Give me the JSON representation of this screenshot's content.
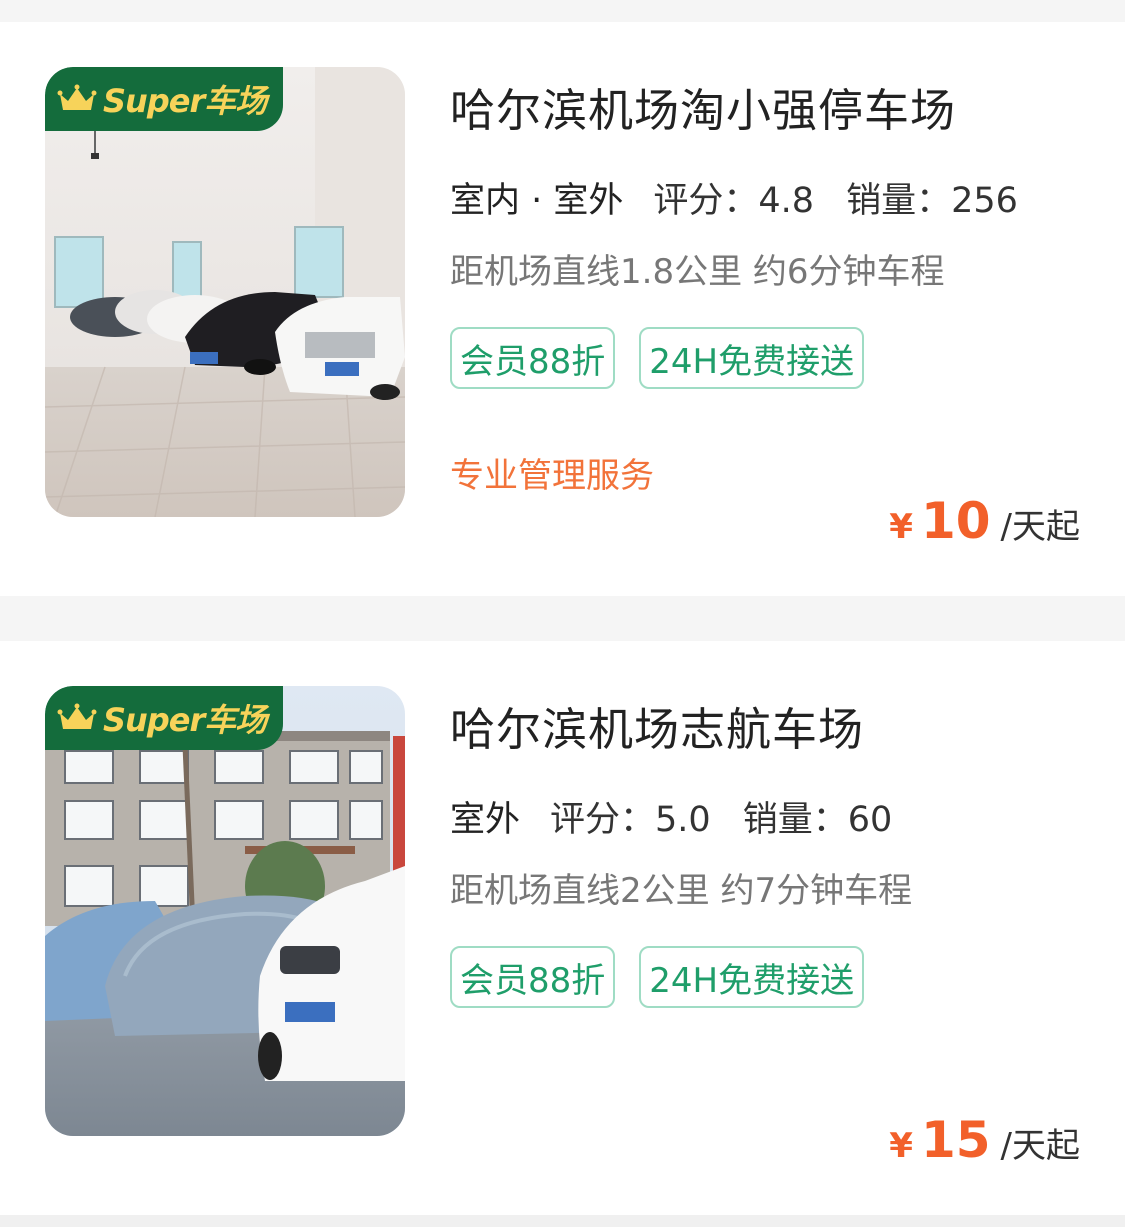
{
  "listings": [
    {
      "badge": "Super车场",
      "title": "哈尔滨机场淘小强停车场",
      "environment": "室内 · 室外",
      "rating_label": "评分：",
      "rating": "4.8",
      "sales_label": "销量：",
      "sales": "256",
      "distance": "距机场直线1.8公里 约6分钟车程",
      "tags": [
        "会员88折",
        "24H免费接送"
      ],
      "note": "专业管理服务",
      "currency": "¥",
      "price": "10",
      "price_unit": "/天起"
    },
    {
      "badge": "Super车场",
      "title": "哈尔滨机场志航车场",
      "environment": "室外",
      "rating_label": "评分：",
      "rating": "5.0",
      "sales_label": "销量：",
      "sales": "60",
      "distance": "距机场直线2公里 约7分钟车程",
      "tags": [
        "会员88折",
        "24H免费接送"
      ],
      "currency": "¥",
      "price": "15",
      "price_unit": "/天起"
    }
  ],
  "colors": {
    "badge_bg": "#146c3c",
    "badge_text": "#f7d35a",
    "tag_text": "#1f9e6a",
    "tag_border": "#9fdcc4",
    "price": "#f2602a",
    "note": "#f2733a",
    "page_bg": "#f5f5f5"
  }
}
